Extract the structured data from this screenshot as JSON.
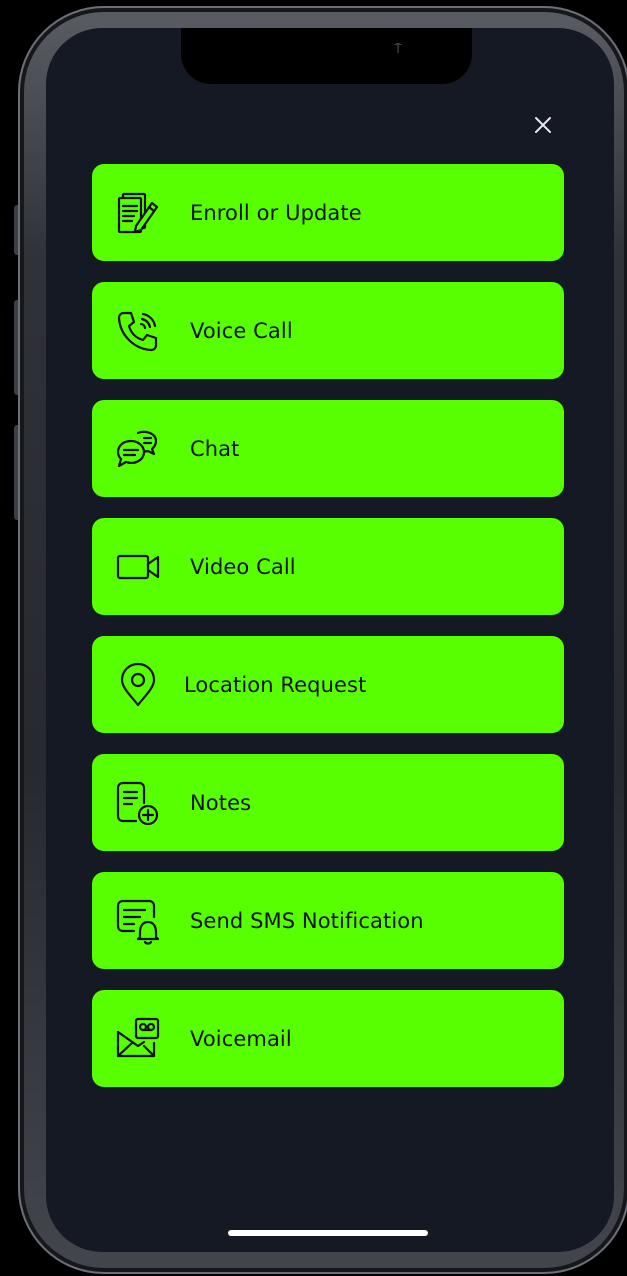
{
  "close_button": {
    "icon": "close-icon",
    "glyph": "✕"
  },
  "notch": {
    "indicator": "⍑"
  },
  "menu": {
    "items": [
      {
        "label": "Enroll or Update",
        "icon": "enroll-document-pencil-icon"
      },
      {
        "label": "Voice Call",
        "icon": "phone-call-icon"
      },
      {
        "label": "Chat",
        "icon": "chat-bubbles-icon"
      },
      {
        "label": "Video Call",
        "icon": "video-camera-icon"
      },
      {
        "label": "Location Request",
        "icon": "location-pin-icon"
      },
      {
        "label": "Notes",
        "icon": "note-add-icon"
      },
      {
        "label": "Send SMS Notification",
        "icon": "sms-bell-icon"
      },
      {
        "label": "Voicemail",
        "icon": "voicemail-envelope-icon"
      }
    ]
  },
  "colors": {
    "accent": "#57ff00",
    "screen_background": "#141923",
    "text": "#111111"
  }
}
